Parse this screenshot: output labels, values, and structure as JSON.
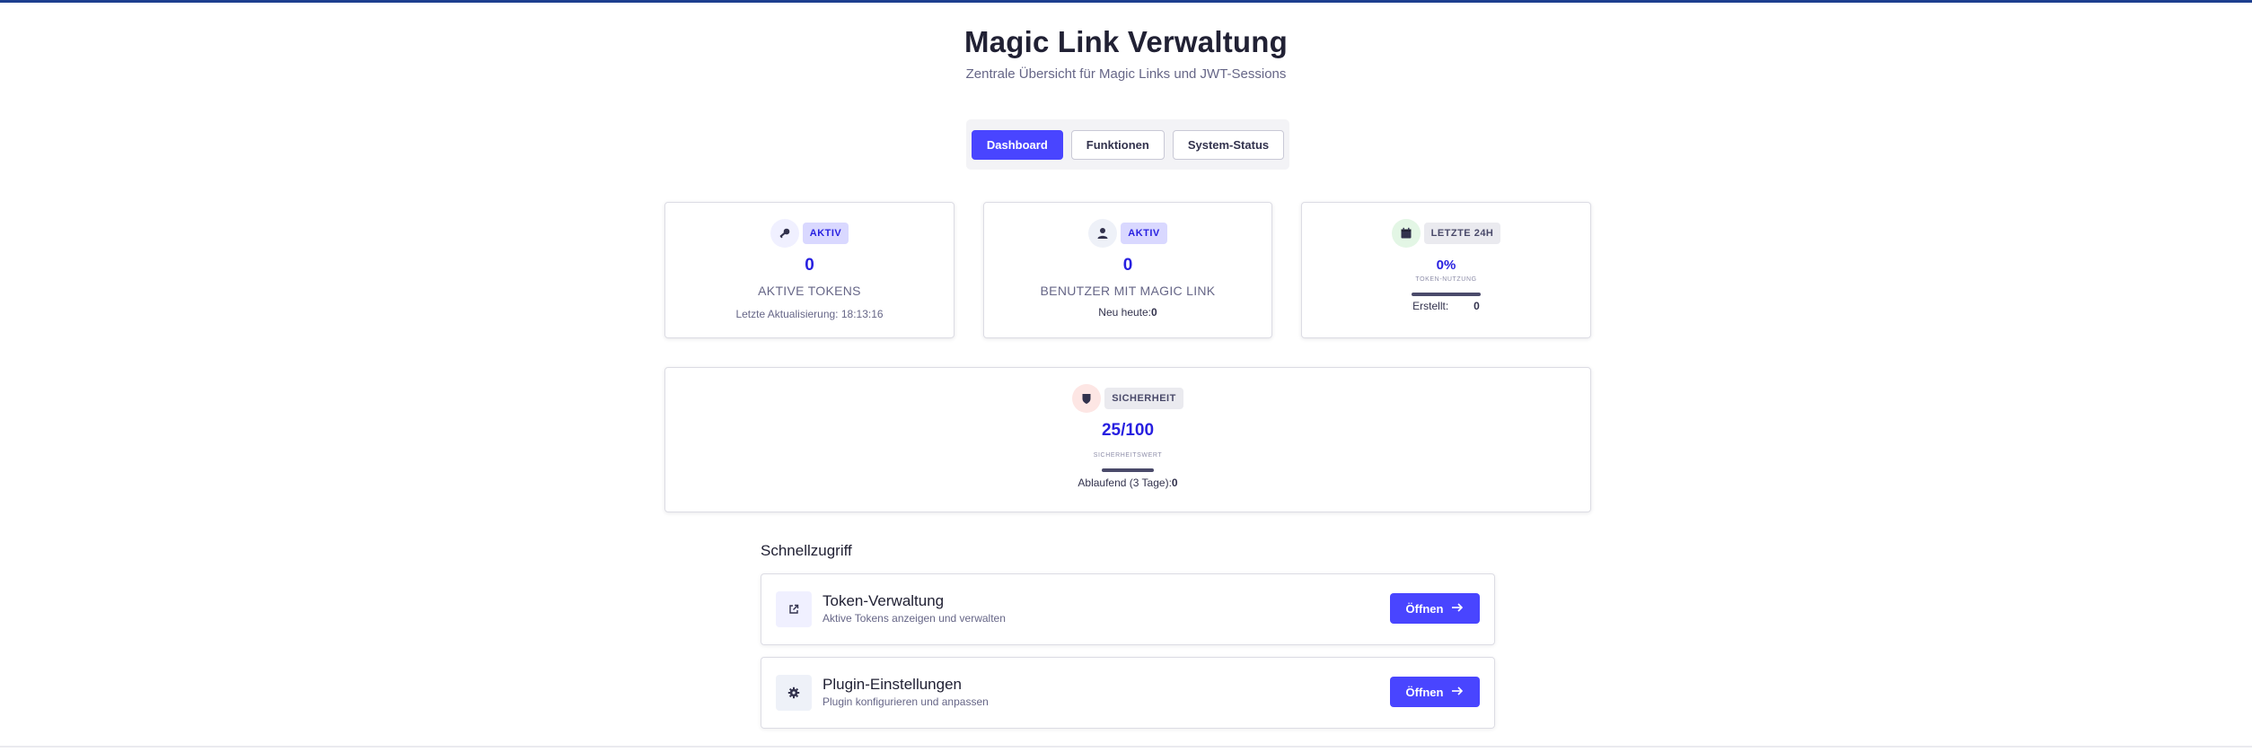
{
  "header": {
    "title": "Magic Link Verwaltung",
    "subtitle": "Zentrale Übersicht für Magic Links und JWT-Sessions"
  },
  "tabs": [
    {
      "label": "Dashboard",
      "active": true
    },
    {
      "label": "Funktionen",
      "active": false
    },
    {
      "label": "System-Status",
      "active": false
    }
  ],
  "cards": {
    "tokens": {
      "icon": "key-icon",
      "badge": "AKTIV",
      "value": "0",
      "label": "AKTIVE TOKENS",
      "meta": "Letzte Aktualisierung: 18:13:16"
    },
    "users": {
      "icon": "user-icon",
      "badge": "AKTIV",
      "value": "0",
      "label": "BENUTZER MIT MAGIC LINK",
      "meta_label": "Neu heute:",
      "meta_value": "0"
    },
    "last24h": {
      "icon": "calendar-icon",
      "badge": "LETZTE 24H",
      "value": "0%",
      "sublabel": "TOKEN-NUTZUNG",
      "meta_label": "Erstellt:",
      "meta_value": "0"
    },
    "security": {
      "icon": "shield-icon",
      "badge": "SICHERHEIT",
      "value": "25/100",
      "sublabel": "SICHERHEITSWERT",
      "meta_label": "Ablaufend (3 Tage):",
      "meta_value": "0",
      "score_fraction": 0.25
    }
  },
  "quick_access": {
    "title": "Schnellzugriff",
    "items": [
      {
        "icon": "external-link-icon",
        "name": "Token-Verwaltung",
        "description": "Aktive Tokens anzeigen und verwalten",
        "button": "Öffnen"
      },
      {
        "icon": "gear-icon",
        "name": "Plugin-Einstellungen",
        "description": "Plugin konfigurieren und anpassen",
        "button": "Öffnen"
      }
    ]
  },
  "colors": {
    "primary": "#4945ff",
    "accent_text": "#271fe0",
    "top_line": "#1d3f8f"
  }
}
